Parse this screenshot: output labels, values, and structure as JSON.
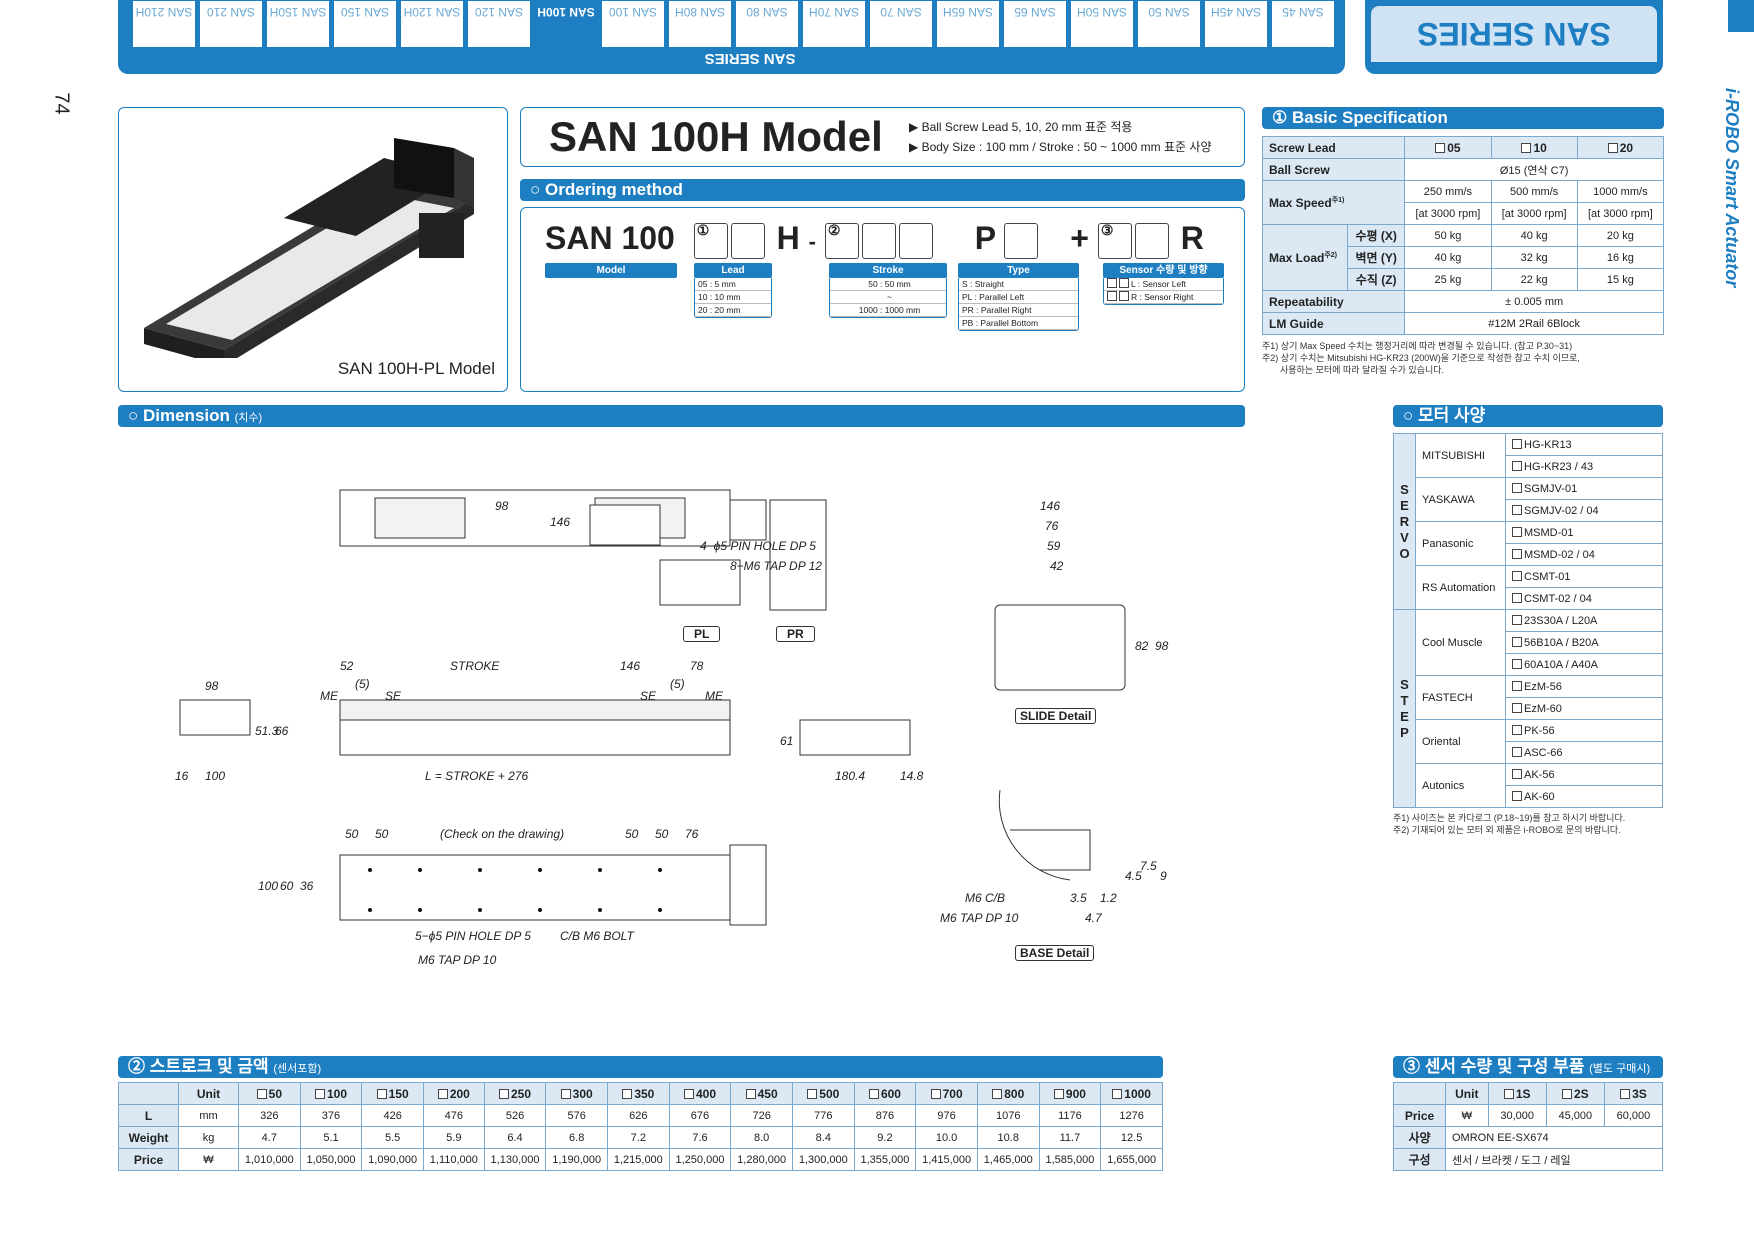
{
  "page_number": "74",
  "series_banner": "SAN SERIES",
  "series_tab_caption": "SAN SERIES",
  "side_label": "i-ROBO Smart Actuator",
  "tabs": [
    "SAN 45",
    "SAN 45H",
    "SAN 50",
    "SAN 50H",
    "SAN 65",
    "SAN 65H",
    "SAN 70",
    "SAN 70H",
    "SAN 80",
    "SAN 80H",
    "SAN 100",
    "SAN 100H",
    "SAN 120",
    "SAN 120H",
    "SAN 150",
    "SAN 150H",
    "SAN 210",
    "SAN 210H"
  ],
  "active_tab": "SAN 100H",
  "product": {
    "image_caption": "SAN 100H-PL Model",
    "title": "SAN 100H Model",
    "bullet1": "▶ Ball Screw Lead 5, 10, 20 mm 표준 적용",
    "bullet2": "▶ Body Size : 100 mm / Stroke : 50 ~ 1000 mm 표준 사양"
  },
  "ordering": {
    "header": "○ Ordering method",
    "code_prefix": "SAN 100",
    "h": "H",
    "dash": "-",
    "p": "P",
    "plus": "+",
    "r": "R",
    "circle1": "①",
    "circle2": "②",
    "circle3": "③",
    "model_label": "Model",
    "lead_label": "Lead",
    "lead_items": [
      "05 : 5 mm",
      "10 : 10 mm",
      "20 : 20 mm"
    ],
    "stroke_label": "Stroke",
    "stroke_items": [
      "50 : 50 mm",
      "~",
      "1000 : 1000 mm"
    ],
    "type_label": "Type",
    "type_items": [
      "S : Straight",
      "PL : Parallel Left",
      "PR : Parallel Right",
      "PB : Parallel Bottom"
    ],
    "sensor_label": "Sensor 수량 및 방향",
    "sensor_items": [
      "L : Sensor Left",
      "R : Sensor Right"
    ]
  },
  "basic_spec": {
    "header": "① Basic Specification",
    "screw_lead": "Screw Lead",
    "leads": [
      "05",
      "10",
      "20"
    ],
    "ball_screw": "Ball Screw",
    "ball_screw_value": "Ø15 (연삭 C7)",
    "max_speed": "Max Speed",
    "max_speed_note": "주1)",
    "speeds": [
      "250 mm/s",
      "500 mm/s",
      "1000 mm/s"
    ],
    "rpm": [
      "[at 3000 rpm]",
      "[at 3000 rpm]",
      "[at 3000 rpm]"
    ],
    "max_load": "Max Load",
    "max_load_note": "주2)",
    "load_rows": [
      {
        "label": "수평 (X)",
        "values": [
          "50 kg",
          "40 kg",
          "20 kg"
        ]
      },
      {
        "label": "벽면 (Y)",
        "values": [
          "40 kg",
          "32 kg",
          "16 kg"
        ]
      },
      {
        "label": "수직 (Z)",
        "values": [
          "25 kg",
          "22 kg",
          "15 kg"
        ]
      }
    ],
    "repeatability": "Repeatability",
    "repeatability_value": "± 0.005 mm",
    "lm_guide": "LM Guide",
    "lm_guide_value": "#12M 2Rail 6Block",
    "note1": "주1) 상기 Max Speed 수치는 행정거리에 따라 변경될 수 있습니다. (참고 P.30~31)",
    "note2": "주2) 상기 수치는 Mitsubishi HG-KR23 (200W)을 기준으로 작성한 참고 수치 이므로,",
    "note3": "사용하는 모터에 따라 달라질 수가 있습니다."
  },
  "dimension": {
    "header": "○ Dimension",
    "header_small": "(치수)",
    "labels": {
      "pl": "PL",
      "pr": "PR",
      "slide_detail": "SLIDE Detail",
      "base_detail": "BASE Detail",
      "pin_hole": "4−ϕ5 PIN HOLE DP 5",
      "tap": "8−M6 TAP DP 12",
      "stroke": "STROKE",
      "l_formula": "L = STROKE + 276",
      "check": "(Check on the drawing)",
      "pin5": "5−ϕ5 PIN HOLE DP 5",
      "cb_bolt": "C/B M6 BOLT",
      "m6tap10": "M6 TAP DP 10",
      "m6cb": "M6 C/B",
      "m6tap10b": "M6 TAP DP 10",
      "me": "ME",
      "se": "SE"
    },
    "values": {
      "d146a": "146",
      "d98a": "98",
      "d146b": "146",
      "d76": "76",
      "d59": "59",
      "d42": "42",
      "d82": "82",
      "d98b": "98",
      "d52": "52",
      "d146c": "146",
      "d78": "78",
      "d5a": "(5)",
      "d5b": "(5)",
      "d98c": "98",
      "d51_3": "51.3",
      "d66": "66",
      "d16": "16",
      "d100": "100",
      "d61": "61",
      "d180_4": "180.4",
      "d14_8": "14.8",
      "d50a": "50",
      "d50b": "50",
      "d50c": "50",
      "d50d": "50",
      "d76b": "76",
      "d100b": "100",
      "d60": "60",
      "d36": "36",
      "d3_5": "3.5",
      "d1_2": "1.2",
      "d4_7": "4.7",
      "d4_5": "4.5",
      "d7_5": "7.5",
      "d9": "9"
    }
  },
  "motor": {
    "header": "○ 모터 사양",
    "servo": "SERVO",
    "step": "STEP",
    "groups": [
      {
        "brand": "MITSUBISHI",
        "items": [
          "HG-KR13",
          "HG-KR23 / 43"
        ]
      },
      {
        "brand": "YASKAWA",
        "items": [
          "SGMJV-01",
          "SGMJV-02 / 04"
        ]
      },
      {
        "brand": "Panasonic",
        "items": [
          "MSMD-01",
          "MSMD-02 / 04"
        ]
      },
      {
        "brand": "RS Automation",
        "items": [
          "CSMT-01",
          "CSMT-02 / 04"
        ]
      },
      {
        "brand": "Cool Muscle",
        "items": [
          "23S30A / L20A",
          "56B10A / B20A",
          "60A10A / A40A"
        ]
      },
      {
        "brand": "FASTECH",
        "items": [
          "EzM-56",
          "EzM-60"
        ]
      },
      {
        "brand": "Oriental",
        "items": [
          "PK-56",
          "ASC-66"
        ]
      },
      {
        "brand": "Autonics",
        "items": [
          "AK-56",
          "AK-60"
        ]
      }
    ],
    "note1": "주1) 사이즈는 본 카다로그 (P.18~19)를 참고 하시기 바랍니다.",
    "note2": "주2) 기재되어 있는 모터 외 제품은 i-ROBO로 문의 바랍니다."
  },
  "price": {
    "header": "② 스트로크 및 금액",
    "header_small": "(센서포함)",
    "unit_label": "Unit",
    "strokes": [
      "50",
      "100",
      "150",
      "200",
      "250",
      "300",
      "350",
      "400",
      "450",
      "500",
      "600",
      "700",
      "800",
      "900",
      "1000"
    ],
    "rows": [
      {
        "label": "L",
        "unit": "mm",
        "values": [
          "326",
          "376",
          "426",
          "476",
          "526",
          "576",
          "626",
          "676",
          "726",
          "776",
          "876",
          "976",
          "1076",
          "1176",
          "1276"
        ]
      },
      {
        "label": "Weight",
        "unit": "kg",
        "values": [
          "4.7",
          "5.1",
          "5.5",
          "5.9",
          "6.4",
          "6.8",
          "7.2",
          "7.6",
          "8.0",
          "8.4",
          "9.2",
          "10.0",
          "10.8",
          "11.7",
          "12.5"
        ]
      },
      {
        "label": "Price",
        "unit": "₩",
        "values": [
          "1,010,000",
          "1,050,000",
          "1,090,000",
          "1,110,000",
          "1,130,000",
          "1,190,000",
          "1,215,000",
          "1,250,000",
          "1,280,000",
          "1,300,000",
          "1,355,000",
          "1,415,000",
          "1,465,000",
          "1,585,000",
          "1,655,000"
        ]
      }
    ]
  },
  "sensor": {
    "header": "③ 센서 수량 및 구성 부품",
    "header_small": "(별도 구매시)",
    "unit_label": "Unit",
    "cols": [
      "1S",
      "2S",
      "3S"
    ],
    "price_label": "Price",
    "price_unit": "₩",
    "prices": [
      "30,000",
      "45,000",
      "60,000"
    ],
    "spec_label": "사양",
    "spec_value": "OMRON   EE-SX674",
    "comp_label": "구성",
    "comp_value": "센서 / 브라켓 / 도그 / 레일"
  },
  "colors": {
    "accent": "#1e7ec2",
    "header_bg": "#dce9f5"
  }
}
